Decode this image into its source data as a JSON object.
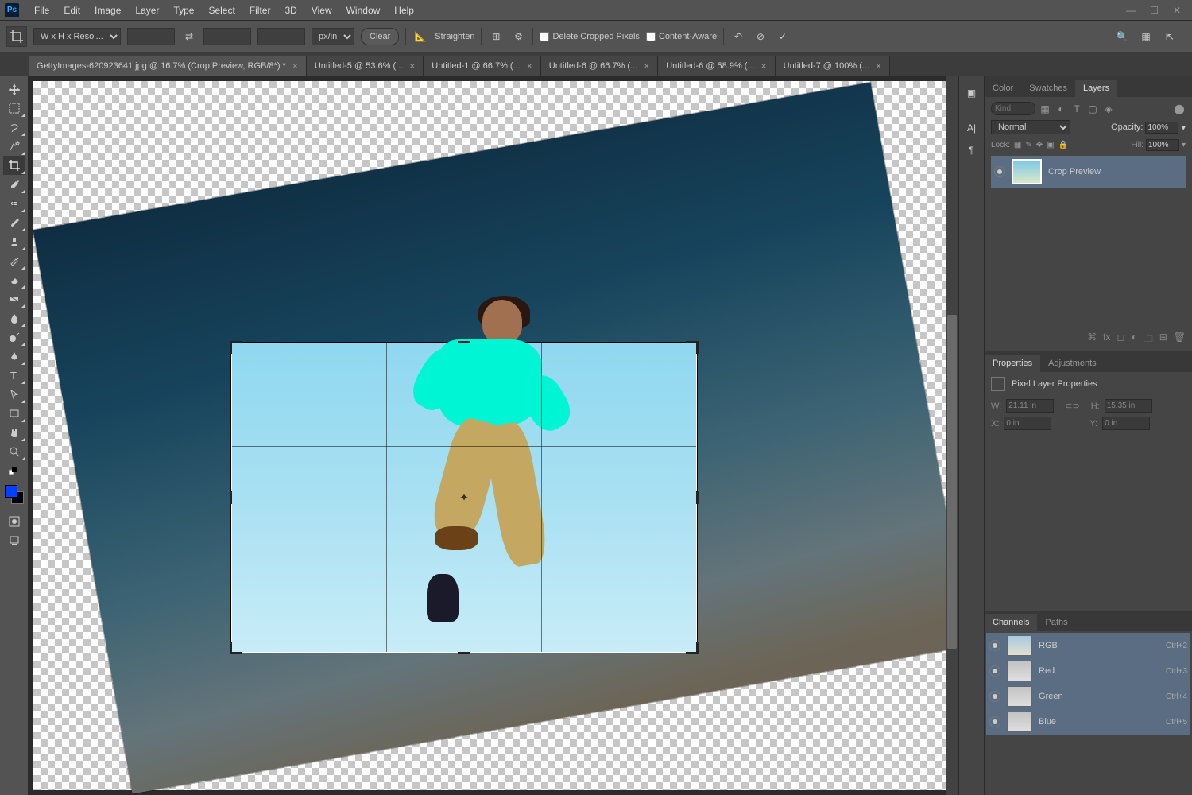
{
  "menu": {
    "items": [
      "File",
      "Edit",
      "Image",
      "Layer",
      "Type",
      "Select",
      "Filter",
      "3D",
      "View",
      "Window",
      "Help"
    ]
  },
  "options": {
    "ratio_preset": "W x H x Resol...",
    "unit": "px/in",
    "clear": "Clear",
    "straighten": "Straighten",
    "delete_cropped": "Delete Cropped Pixels",
    "content_aware": "Content-Aware"
  },
  "tabs": [
    {
      "label": "GettyImages-620923641.jpg @ 16.7% (Crop Preview, RGB/8*) *",
      "active": true
    },
    {
      "label": "Untitled-5 @ 53.6% (...",
      "active": false
    },
    {
      "label": "Untitled-1 @ 66.7% (...",
      "active": false
    },
    {
      "label": "Untitled-6 @ 66.7% (...",
      "active": false
    },
    {
      "label": "Untitled-6 @ 58.9% (...",
      "active": false
    },
    {
      "label": "Untitled-7 @ 100% (...",
      "active": false
    }
  ],
  "layers_panel": {
    "tabs": [
      "Color",
      "Swatches",
      "Layers"
    ],
    "kind_placeholder": "Kind",
    "blend": "Normal",
    "opacity_label": "Opacity:",
    "opacity": "100%",
    "lock_label": "Lock:",
    "fill_label": "Fill:",
    "fill": "100%",
    "layer_name": "Crop Preview"
  },
  "properties": {
    "tabs": [
      "Properties",
      "Adjustments"
    ],
    "title": "Pixel Layer Properties",
    "w_label": "W:",
    "w": "21.11 in",
    "h_label": "H:",
    "h": "15.35 in",
    "x_label": "X:",
    "x": "0 in",
    "y_label": "Y:",
    "y": "0 in"
  },
  "channels": {
    "tabs": [
      "Channels",
      "Paths"
    ],
    "items": [
      {
        "name": "RGB",
        "shortcut": "Ctrl+2"
      },
      {
        "name": "Red",
        "shortcut": "Ctrl+3"
      },
      {
        "name": "Green",
        "shortcut": "Ctrl+4"
      },
      {
        "name": "Blue",
        "shortcut": "Ctrl+5"
      }
    ]
  }
}
